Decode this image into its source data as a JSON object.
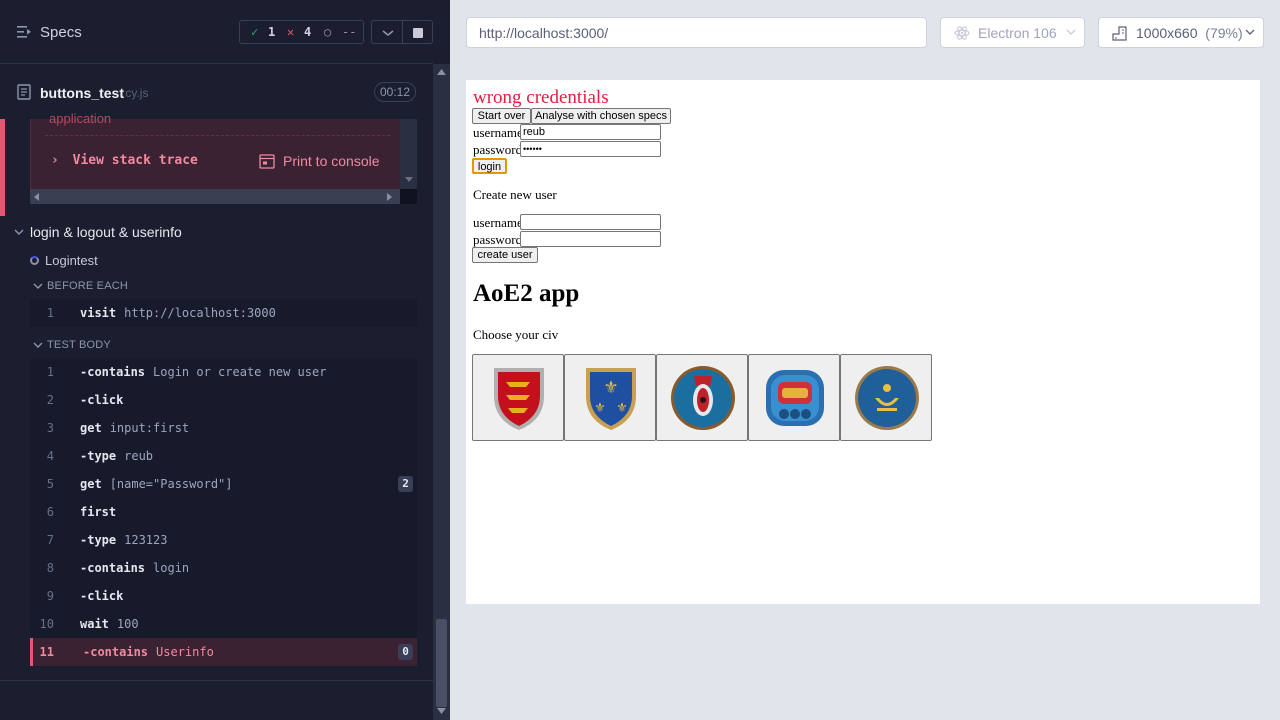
{
  "header": {
    "specs_label": "Specs",
    "passed_count": "1",
    "failed_count": "4",
    "pending_count": "--"
  },
  "file": {
    "name": "buttons_test",
    "ext": ".cy.js",
    "duration": "00:12"
  },
  "error": {
    "cut_text": "application",
    "stack_trace_label": "View stack trace",
    "print_console_label": "Print to console"
  },
  "suite": {
    "title": "login & logout & userinfo",
    "test_title": "Logintest",
    "before_each_label": "BEFORE EACH",
    "test_body_label": "TEST BODY"
  },
  "before_each_commands": [
    {
      "num": "1",
      "name": "visit",
      "msg": "http://localhost:3000"
    }
  ],
  "test_body_commands": [
    {
      "num": "1",
      "name": "-contains",
      "msg": "Login or create new user"
    },
    {
      "num": "2",
      "name": "-click",
      "msg": ""
    },
    {
      "num": "3",
      "name": "get",
      "msg": "input:first"
    },
    {
      "num": "4",
      "name": "-type",
      "msg": "reub"
    },
    {
      "num": "5",
      "name": "get",
      "msg": "[name=\"Password\"]",
      "badge": "2"
    },
    {
      "num": "6",
      "name": "first",
      "msg": ""
    },
    {
      "num": "7",
      "name": "-type",
      "msg": "123123"
    },
    {
      "num": "8",
      "name": "-contains",
      "msg": "login"
    },
    {
      "num": "9",
      "name": "-click",
      "msg": ""
    },
    {
      "num": "10",
      "name": "wait",
      "msg": "100"
    },
    {
      "num": "11",
      "name": "-contains",
      "msg": "Userinfo",
      "badge": "0",
      "failed": true
    }
  ],
  "browser": {
    "url": "http://localhost:3000/",
    "browser_name": "Electron 106",
    "viewport": "1000x660",
    "zoom": "(79%)"
  },
  "app": {
    "error_message": "wrong credentials",
    "start_over_label": "Start over",
    "analyse_label": "Analyse with chosen specs",
    "username_label": "username",
    "username_value": "reub",
    "password_label": "password",
    "password_value": "••••••",
    "login_label": "login",
    "create_heading": "Create new user",
    "new_username_label": "username",
    "new_password_label": "password",
    "create_user_label": "create user",
    "title": "AoE2 app",
    "choose_civ": "Choose your civ",
    "civs": [
      "britons-emblem-icon",
      "franks-emblem-icon",
      "aztecs-emblem-icon",
      "mayans-emblem-icon",
      "mongols-emblem-icon"
    ]
  },
  "colors": {
    "pass": "#1fa971",
    "fail": "#e45770",
    "error_text": "#e02040",
    "accent": "#4956e3"
  }
}
